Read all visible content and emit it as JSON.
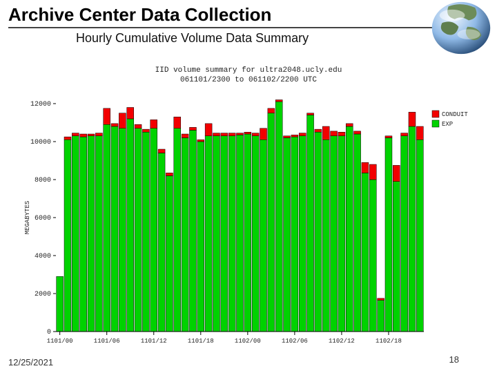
{
  "header": {
    "title": "Archive Center Data Collection",
    "subtitle": "Hourly Cumulative Volume Data Summary"
  },
  "footer": {
    "date": "12/25/2021",
    "page": "18"
  },
  "chart_data": {
    "type": "bar",
    "title": "IID volume summary for ultra2048.ucly.edu",
    "subtitle": "061101/2300 to 061102/2200 UTC",
    "xlabel": "",
    "ylabel": "MEGABYTES",
    "ylim": [
      0,
      12000
    ],
    "yticks": [
      0,
      2000,
      4000,
      6000,
      8000,
      10000,
      12000
    ],
    "categories": [
      "1101/00",
      "1101/01",
      "1101/02",
      "1101/03",
      "1101/04",
      "1101/05",
      "1101/06",
      "1101/07",
      "1101/08",
      "1101/09",
      "1101/10",
      "1101/11",
      "1101/12",
      "1101/13",
      "1101/14",
      "1101/15",
      "1101/16",
      "1101/17",
      "1101/18",
      "1101/19",
      "1101/20",
      "1101/21",
      "1101/22",
      "1101/23",
      "1102/00",
      "1102/01",
      "1102/02",
      "1102/03",
      "1102/04",
      "1102/05",
      "1102/06",
      "1102/07",
      "1102/08",
      "1102/09",
      "1102/10",
      "1102/11",
      "1102/12",
      "1102/13",
      "1102/14",
      "1102/15",
      "1102/16",
      "1102/17",
      "1102/18",
      "1102/19",
      "1102/20",
      "1102/21",
      "1102/22"
    ],
    "xtick_labels": [
      "1101/00",
      "1101/06",
      "1101/12",
      "1101/18",
      "1102/00",
      "1102/06",
      "1102/12",
      "1102/18"
    ],
    "series": [
      {
        "name": "EXP",
        "color": "#00d200",
        "values": [
          2900,
          10100,
          10300,
          10250,
          10300,
          10300,
          10900,
          10800,
          10700,
          11200,
          10700,
          10500,
          10700,
          9400,
          8200,
          10700,
          10200,
          10600,
          10000,
          10300,
          10300,
          10300,
          10300,
          10350,
          10400,
          10300,
          10100,
          11500,
          12100,
          10200,
          10250,
          10300,
          11400,
          10500,
          10100,
          10300,
          10300,
          10800,
          10400,
          8350,
          8000,
          1650,
          10200,
          7900,
          10300,
          10800,
          10100
        ]
      },
      {
        "name": "CONDUIT",
        "color": "#f20000",
        "values": [
          0,
          150,
          150,
          150,
          100,
          150,
          850,
          150,
          800,
          600,
          200,
          150,
          450,
          200,
          150,
          600,
          200,
          150,
          100,
          650,
          150,
          150,
          150,
          100,
          100,
          150,
          600,
          250,
          100,
          100,
          100,
          150,
          100,
          150,
          700,
          250,
          200,
          150,
          150,
          550,
          800,
          100,
          100,
          850,
          150,
          750,
          700
        ]
      }
    ],
    "legend": {
      "position": "right",
      "entries": [
        "CONDUIT",
        "EXP"
      ]
    }
  }
}
